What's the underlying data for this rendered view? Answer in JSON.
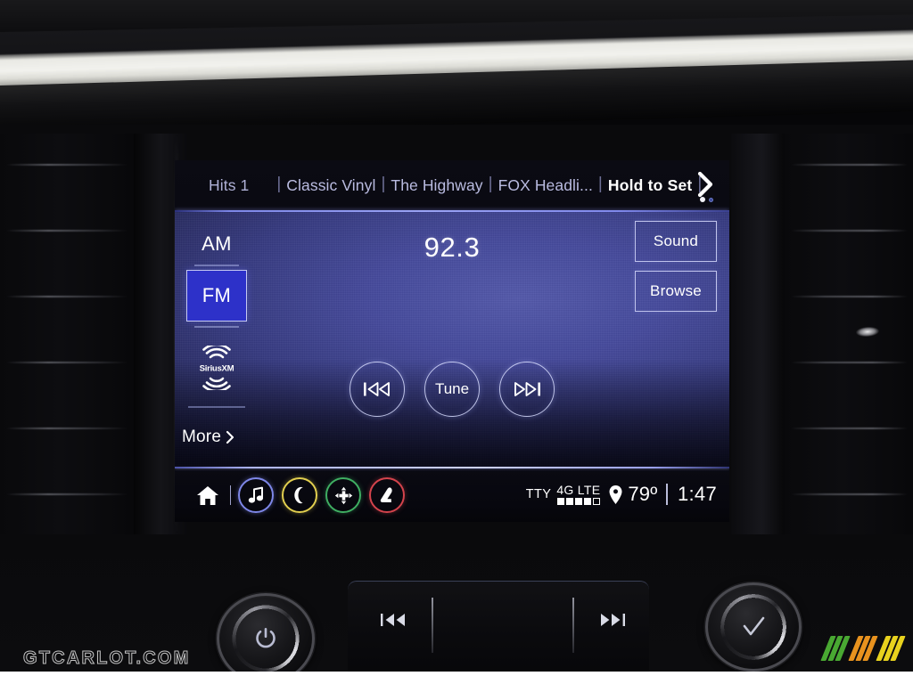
{
  "screen": {
    "presets": {
      "items": [
        {
          "label": "Hits 1",
          "bold": false
        },
        {
          "label": "Classic Vinyl",
          "bold": false
        },
        {
          "label": "The Highway",
          "bold": false
        },
        {
          "label": "FOX Headli...",
          "bold": false
        },
        {
          "label": "Hold to Set",
          "bold": true
        }
      ],
      "separator": "|",
      "next_page_icon": "chevron-right-icon",
      "page_dots": 2,
      "active_dot": 1
    },
    "radio": {
      "band_am_label": "AM",
      "band_fm_label": "FM",
      "active_band": "FM",
      "frequency": "92.3",
      "satellite_label": "SiriusXM",
      "more_label": "More",
      "more_chevron": "chevron-right-icon",
      "transport": [
        {
          "name": "previous-track-button",
          "icon": "skip-back-icon",
          "label": ""
        },
        {
          "name": "tune-button",
          "icon": "",
          "label": "Tune"
        },
        {
          "name": "next-track-button",
          "icon": "skip-forward-icon",
          "label": ""
        }
      ],
      "side_buttons": [
        {
          "name": "sound-button",
          "label": "Sound"
        },
        {
          "name": "browse-button",
          "label": "Browse"
        }
      ]
    },
    "status_bar": {
      "home_icon": "home-icon",
      "shortcuts": [
        {
          "name": "audio-shortcut",
          "icon": "music-note-icon",
          "color": "#7e87e8"
        },
        {
          "name": "phone-shortcut",
          "icon": "phone-icon",
          "color": "#e2cf4f"
        },
        {
          "name": "navigation-shortcut",
          "icon": "compass-icon",
          "color": "#3fae62"
        },
        {
          "name": "climate-seat-shortcut",
          "icon": "seat-icon",
          "color": "#d4434c"
        }
      ],
      "tty_label": "TTY",
      "network_label": "4G LTE",
      "signal_bars_total": 5,
      "signal_bars_filled": 4,
      "location_icon": "map-pin-icon",
      "temperature": "79º",
      "separator": "|",
      "clock": "1:47"
    }
  },
  "hardware": {
    "power_knob": {
      "name": "power-knob",
      "icon": "power-icon"
    },
    "confirm_knob": {
      "name": "tune-confirm-knob",
      "icon": "check-icon"
    },
    "buttons": [
      {
        "name": "hard-previous-button",
        "icon": "skip-back-icon"
      },
      {
        "name": "hard-next-button",
        "icon": "skip-forward-icon"
      }
    ]
  },
  "watermark": {
    "text": "GTCARLOT.COM",
    "logo_colors": [
      "#49a832",
      "#49a832",
      "#49a832",
      "#e8921e",
      "#e8921e",
      "#e8921e",
      "#e8d21e",
      "#e8d21e",
      "#e8d21e"
    ]
  },
  "colors": {
    "panel_blue": "#454a9c",
    "accent_blue": "#2d31c9",
    "divider_glow": "#9aa3f5"
  }
}
